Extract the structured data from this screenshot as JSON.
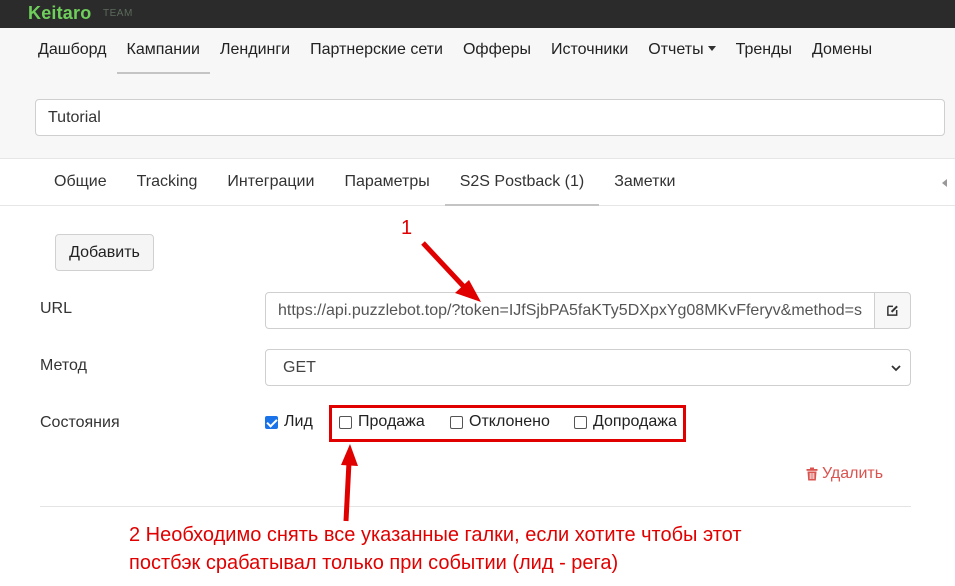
{
  "brand": {
    "logo": "Keitaro",
    "badge": "TEAM"
  },
  "nav": {
    "items": [
      {
        "label": "Дашборд"
      },
      {
        "label": "Кампании"
      },
      {
        "label": "Лендинги"
      },
      {
        "label": "Партнерские сети"
      },
      {
        "label": "Офферы"
      },
      {
        "label": "Источники"
      },
      {
        "label": "Отчеты"
      },
      {
        "label": "Тренды"
      },
      {
        "label": "Домены"
      }
    ],
    "active": "Кампании"
  },
  "campaign": {
    "name": "Tutorial"
  },
  "tabs": {
    "items": [
      {
        "label": "Общие"
      },
      {
        "label": "Tracking"
      },
      {
        "label": "Интеграции"
      },
      {
        "label": "Параметры"
      },
      {
        "label": "S2S Postback (1)"
      },
      {
        "label": "Заметки"
      }
    ],
    "active": "S2S Postback (1)"
  },
  "postback": {
    "add_label": "Добавить",
    "url_label": "URL",
    "url_value": "https://api.puzzlebot.top/?token=IJfSjbPA5faKTy5DXpxYg08MKvFferyv&method=s",
    "method_label": "Метод",
    "method_value": "GET",
    "states_label": "Состояния",
    "states": [
      {
        "label": "Лид",
        "checked": true
      },
      {
        "label": "Продажа",
        "checked": false
      },
      {
        "label": "Отклонено",
        "checked": false
      },
      {
        "label": "Допродажа",
        "checked": false
      }
    ],
    "delete_label": "Удалить"
  },
  "annotations": {
    "marker_1": "1",
    "note_2": "2 Необходимо снять все указанные галки, если хотите чтобы этот постбэк срабатывал только при событии (лид - рега)"
  },
  "colors": {
    "accent_green": "#6fcf5b",
    "annotation_red": "#e00000",
    "delete_red": "#d9534f",
    "checkbox_blue": "#1a73e8"
  },
  "icons": {
    "edit": "edit-icon",
    "trash": "trash-icon",
    "select": "chevron-down-icon",
    "tab_scroll": "caret-left-icon"
  }
}
